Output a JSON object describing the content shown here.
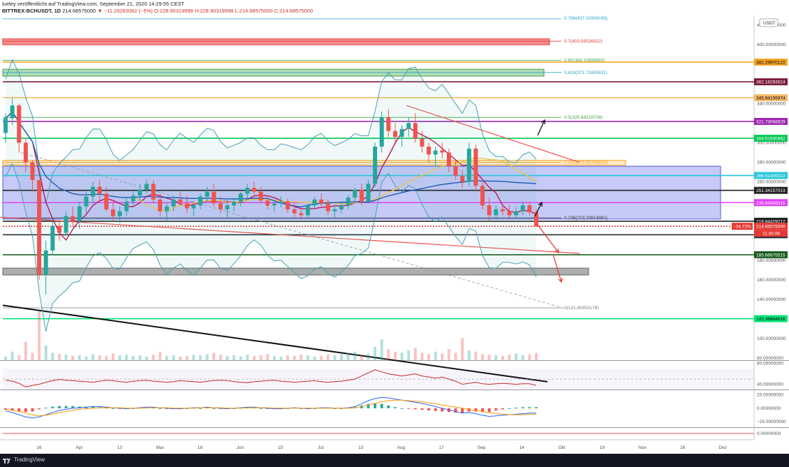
{
  "header": {
    "line1": "lueley veröffentlicht auf TradingView.com, September 21, 2020 14:29:55 CEST",
    "symbol": "BITTREX:BCHUSDT, 1D",
    "price": "214.68575000",
    "change": "−11.29283082 (−5%)",
    "ohlc": "O:228.90319998 H:228.90319998 L:214.68575000 C:214.68575000"
  },
  "footer": {
    "brand": "TradingView"
  },
  "currency_badge": "USDT",
  "chart_data": [
    {
      "type": "candlestick",
      "title": "BITTREX:BCHUSDT, 1D",
      "ylim": [
        78,
        430
      ],
      "yticks": [
        {
          "value": 420,
          "label": "420.00000000"
        },
        {
          "value": 400,
          "label": "400.00000000"
        },
        {
          "value": 340,
          "label": "340.00000000"
        },
        {
          "value": 320,
          "label": "320.00000000"
        },
        {
          "value": 300,
          "label": "300.00000000"
        },
        {
          "value": 280,
          "label": "280.00000000"
        },
        {
          "value": 260,
          "label": "260.00000000"
        },
        {
          "value": 240,
          "label": "240.00000000"
        },
        {
          "value": 180,
          "label": "180.00000000"
        },
        {
          "value": 160,
          "label": "160.00000000"
        },
        {
          "value": 140,
          "label": "140.00000000"
        },
        {
          "value": 100,
          "label": "100.00000000"
        },
        {
          "value": 80,
          "label": "80.00000000"
        },
        {
          "value": 60,
          "label": "60.00000000"
        }
      ],
      "x_labels": [
        "16",
        "Apr",
        "13",
        "Mai",
        "18",
        "Jun",
        "15",
        "Jul",
        "13",
        "Aug",
        "17",
        "Sep",
        "14",
        "Okt",
        "19",
        "Nov",
        "16",
        "Dez"
      ],
      "price_tags": [
        {
          "value": 382.2997,
          "label": "382.29970122",
          "color": "#f5a623",
          "text": "#000"
        },
        {
          "value": 362.1829,
          "label": "362.18293524",
          "color": "#7b1b3a",
          "text": "#fff"
        },
        {
          "value": 345.9419,
          "label": "345.94195974",
          "color": "#f7b96a",
          "text": "#000"
        },
        {
          "value": 321.7307,
          "label": "321.73068929",
          "color": "#9c27b0",
          "text": "#fff"
        },
        {
          "value": 304.5193,
          "label": "304.51930882",
          "color": "#00c853",
          "text": "#fff"
        },
        {
          "value": 266.514,
          "label": "266.51400022",
          "color": "#26c6da",
          "text": "#fff"
        },
        {
          "value": 251.3416,
          "label": "251.34157013",
          "color": "#212121",
          "text": "#fff"
        },
        {
          "value": 238.8499,
          "label": "238.84988315",
          "color": "#e040fb",
          "text": "#fff"
        },
        {
          "value": 219.8443,
          "label": "219.84429212",
          "color": "#212121",
          "text": "#fff"
        },
        {
          "value": 214.6858,
          "label": "214.68575000",
          "color": "#e53935",
          "text": "#fff"
        },
        {
          "value": 206.0508,
          "label": "206.05080873",
          "color": "#263238",
          "text": "#fff"
        },
        {
          "value": 185.6676,
          "label": "185.66675515",
          "color": "#1b5e20",
          "text": "#fff"
        },
        {
          "value": 120.3688,
          "label": "120.36884016",
          "color": "#00e676",
          "text": "#000"
        }
      ],
      "countdown": "11:30:08",
      "pct_badge": "−34.72%",
      "fib_levels": [
        {
          "label": "0.786(437.02908165)",
          "value": 437.03,
          "color": "#26a6c8"
        },
        {
          "label": "0.7(403.59526322)",
          "value": 403.6,
          "color": "#e53935"
        },
        {
          "label": "0.65(384.15699665)",
          "value": 384.16,
          "color": "#43a047"
        },
        {
          "label": "0.618(371.71650611)",
          "value": 371.72,
          "color": "#26a6c8"
        },
        {
          "label": "0.5(325.84219709)",
          "value": 325.84,
          "color": "#43a047"
        },
        {
          "label": "0.382(279.96788808)",
          "value": 279.97,
          "color": "#f5a623"
        },
        {
          "label": "0.236(223.20814981)",
          "value": 223.21,
          "color": "#333333"
        },
        {
          "label": "0(131.45953178)",
          "value": 131.46,
          "color": "#787b86"
        }
      ],
      "candles": [
        [
          310,
          330,
          300,
          325
        ],
        [
          325,
          345,
          318,
          338
        ],
        [
          338,
          340,
          290,
          300
        ],
        [
          300,
          305,
          270,
          280
        ],
        [
          280,
          282,
          250,
          262
        ],
        [
          262,
          262,
          160,
          165
        ],
        [
          165,
          200,
          145,
          190
        ],
        [
          190,
          220,
          185,
          215
        ],
        [
          215,
          222,
          200,
          208
        ],
        [
          208,
          230,
          205,
          225
        ],
        [
          225,
          235,
          215,
          220
        ],
        [
          220,
          240,
          212,
          235
        ],
        [
          235,
          250,
          228,
          245
        ],
        [
          245,
          260,
          238,
          255
        ],
        [
          255,
          262,
          240,
          248
        ],
        [
          248,
          255,
          230,
          232
        ],
        [
          232,
          240,
          220,
          225
        ],
        [
          225,
          235,
          218,
          230
        ],
        [
          230,
          245,
          225,
          240
        ],
        [
          240,
          250,
          235,
          246
        ],
        [
          246,
          258,
          240,
          252
        ],
        [
          252,
          262,
          248,
          258
        ],
        [
          258,
          262,
          238,
          242
        ],
        [
          242,
          248,
          225,
          230
        ],
        [
          230,
          238,
          220,
          235
        ],
        [
          235,
          245,
          230,
          242
        ],
        [
          242,
          250,
          236,
          238
        ],
        [
          238,
          246,
          228,
          233
        ],
        [
          233,
          240,
          225,
          236
        ],
        [
          236,
          248,
          232,
          245
        ],
        [
          245,
          255,
          240,
          250
        ],
        [
          250,
          258,
          235,
          238
        ],
        [
          238,
          245,
          228,
          232
        ],
        [
          232,
          240,
          224,
          236
        ],
        [
          236,
          244,
          230,
          240
        ],
        [
          240,
          250,
          235,
          248
        ],
        [
          248,
          258,
          242,
          254
        ],
        [
          254,
          260,
          246,
          250
        ],
        [
          250,
          255,
          238,
          241
        ],
        [
          241,
          246,
          232,
          236
        ],
        [
          236,
          242,
          230,
          238
        ],
        [
          238,
          245,
          234,
          240
        ],
        [
          240,
          243,
          228,
          232
        ],
        [
          232,
          238,
          224,
          228
        ],
        [
          228,
          232,
          222,
          226
        ],
        [
          226,
          238,
          224,
          236
        ],
        [
          236,
          245,
          232,
          242
        ],
        [
          242,
          248,
          235,
          238
        ],
        [
          238,
          242,
          226,
          230
        ],
        [
          230,
          236,
          224,
          232
        ],
        [
          232,
          240,
          228,
          236
        ],
        [
          236,
          246,
          232,
          244
        ],
        [
          244,
          254,
          240,
          252
        ],
        [
          252,
          258,
          236,
          240
        ],
        [
          240,
          262,
          238,
          258
        ],
        [
          258,
          300,
          255,
          296
        ],
        [
          296,
          332,
          290,
          326
        ],
        [
          326,
          334,
          306,
          312
        ],
        [
          312,
          320,
          300,
          306
        ],
        [
          306,
          318,
          296,
          314
        ],
        [
          314,
          326,
          306,
          320
        ],
        [
          320,
          330,
          300,
          304
        ],
        [
          304,
          312,
          290,
          296
        ],
        [
          296,
          300,
          280,
          288
        ],
        [
          288,
          296,
          276,
          292
        ],
        [
          292,
          300,
          284,
          290
        ],
        [
          290,
          294,
          270,
          276
        ],
        [
          276,
          282,
          262,
          266
        ],
        [
          266,
          272,
          254,
          260
        ],
        [
          260,
          300,
          256,
          294
        ],
        [
          294,
          298,
          250,
          256
        ],
        [
          256,
          262,
          232,
          236
        ],
        [
          236,
          244,
          220,
          226
        ],
        [
          226,
          236,
          222,
          232
        ],
        [
          232,
          238,
          226,
          230
        ],
        [
          230,
          236,
          222,
          226
        ],
        [
          226,
          234,
          222,
          230
        ],
        [
          230,
          240,
          226,
          236
        ],
        [
          236,
          240,
          226,
          229
        ],
        [
          229,
          232,
          214,
          214.7
        ]
      ],
      "volume": [
        6,
        14,
        8,
        30,
        12,
        80,
        24,
        12,
        10,
        9,
        7,
        8,
        6,
        10,
        8,
        7,
        11,
        8,
        9,
        7,
        8,
        6,
        9,
        14,
        7,
        8,
        6,
        7,
        9,
        8,
        10,
        12,
        9,
        7,
        8,
        6,
        9,
        7,
        8,
        10,
        7,
        6,
        8,
        7,
        9,
        8,
        6,
        7,
        9,
        8,
        10,
        12,
        14,
        9,
        11,
        22,
        34,
        18,
        14,
        12,
        16,
        20,
        12,
        10,
        14,
        11,
        18,
        12,
        36,
        16,
        14,
        10,
        9,
        8,
        7,
        9,
        11,
        8,
        10,
        12
      ]
    },
    {
      "type": "line",
      "title": "",
      "ylim": [
        30,
        85
      ],
      "yticks": [
        {
          "value": 80,
          "label": "80.00000000"
        },
        {
          "value": 40,
          "label": "40.00000000"
        }
      ],
      "series": [
        {
          "values": [
            48,
            46,
            42,
            35,
            38,
            40,
            44,
            47,
            49,
            48,
            47,
            46,
            45,
            44,
            46,
            48,
            47,
            45,
            44,
            46,
            47,
            48,
            46,
            45,
            44,
            45,
            47,
            46,
            45,
            44,
            46,
            47,
            48,
            47,
            45,
            44,
            43,
            45,
            46,
            47,
            48,
            46,
            45,
            44,
            45,
            46,
            47,
            45,
            44,
            45,
            46,
            48,
            50,
            56,
            62,
            68,
            64,
            60,
            58,
            56,
            58,
            60,
            56,
            54,
            52,
            54,
            50,
            46,
            40,
            42,
            44,
            41,
            40,
            41,
            42,
            41,
            40,
            41,
            41,
            38
          ]
        }
      ]
    },
    {
      "type": "line",
      "title": "",
      "ylim": [
        -35,
        32
      ],
      "yticks": [
        {
          "value": 25,
          "label": "25.00000000"
        },
        {
          "value": 0,
          "label": "0.00000000"
        },
        {
          "value": -25,
          "label": "−25.00000000"
        }
      ],
      "series": [
        {
          "values": [
            -5,
            -8,
            -12,
            -16,
            -18,
            -16,
            -12,
            -8,
            -4,
            -2,
            0,
            1,
            2,
            3,
            3,
            2,
            1,
            0,
            -1,
            0,
            1,
            2,
            2,
            1,
            0,
            -1,
            -1,
            0,
            1,
            1,
            2,
            1,
            0,
            -1,
            0,
            1,
            2,
            2,
            1,
            0,
            -1,
            -1,
            0,
            1,
            0,
            -1,
            0,
            1,
            1,
            0,
            0,
            1,
            3,
            8,
            14,
            18,
            20,
            19,
            17,
            15,
            13,
            11,
            9,
            6,
            3,
            0,
            -3,
            -6,
            -9,
            -8,
            -10,
            -13,
            -15,
            -14,
            -13,
            -12,
            -11,
            -10,
            -9,
            -9
          ]
        },
        {
          "values": [
            -2,
            -4,
            -6,
            -9,
            -12,
            -14,
            -13,
            -11,
            -8,
            -6,
            -4,
            -2,
            -1,
            0,
            1,
            1,
            1,
            1,
            0,
            0,
            0,
            1,
            1,
            1,
            1,
            0,
            0,
            0,
            0,
            1,
            1,
            1,
            1,
            0,
            0,
            0,
            1,
            1,
            1,
            1,
            0,
            0,
            0,
            0,
            0,
            0,
            0,
            0,
            0,
            0,
            0,
            0,
            1,
            3,
            6,
            9,
            12,
            14,
            15,
            15,
            14,
            13,
            12,
            10,
            8,
            6,
            4,
            2,
            0,
            -2,
            -4,
            -6,
            -8,
            -10,
            -11,
            -12,
            -12,
            -12,
            -11,
            -11
          ]
        }
      ]
    },
    {
      "type": "line",
      "title": "",
      "ylim": [
        -1,
        1
      ],
      "yticks": [
        {
          "value": 0,
          "label": "0.00000000"
        }
      ]
    }
  ]
}
